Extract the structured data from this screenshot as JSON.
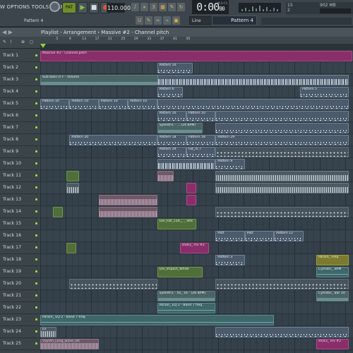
{
  "toolbar": {
    "menu": "W OPTIONS TOOLS HELP",
    "pattern_song_toggle": "PAT",
    "play_icon": "play-icon",
    "stop_icon": "stop-icon",
    "record_icon": "record-icon",
    "tempo": "110.000",
    "time": "0:00",
    "time_small": "00",
    "time_label": "M:S:CS",
    "cpu_value": "15",
    "cpu_value_b": "2",
    "memory": "902 MB",
    "accent_color": "#8dc63f",
    "record_color": "#e0523d"
  },
  "row2": {
    "pattern_label": "Pattern 4",
    "snap": "Line",
    "pattern_select": "Pattern 4"
  },
  "playlist": {
    "nav": "◀ ▶",
    "title": "Playlist - Arrangement › Massive #2 - Channel pitch"
  },
  "ruler": [
    "5",
    "9",
    "13",
    "17",
    "21",
    "25",
    "29",
    "33",
    "37",
    "41",
    "45"
  ],
  "tracks": [
    {
      "name": "Track 1"
    },
    {
      "name": "Track 2"
    },
    {
      "name": "Track 3"
    },
    {
      "name": "Track 4"
    },
    {
      "name": "Track 5"
    },
    {
      "name": "Track 6"
    },
    {
      "name": "Track 7"
    },
    {
      "name": "Track 8"
    },
    {
      "name": "Track 9"
    },
    {
      "name": "Track 10"
    },
    {
      "name": "Track 11"
    },
    {
      "name": "Track 12"
    },
    {
      "name": "Track 13"
    },
    {
      "name": "Track 14"
    },
    {
      "name": "Track 15"
    },
    {
      "name": "Track 16"
    },
    {
      "name": "Track 17"
    },
    {
      "name": "Track 18"
    },
    {
      "name": "Track 19"
    },
    {
      "name": "Track 20"
    },
    {
      "name": "Track 21"
    },
    {
      "name": "Track 22"
    },
    {
      "name": "Track 23"
    },
    {
      "name": "Track 24"
    },
    {
      "name": "Track 25"
    }
  ],
  "clips": [
    {
      "t": 0,
      "b": 1,
      "w": 96,
      "k": "k-pink",
      "label": "Massive #2 - Channel pitch"
    },
    {
      "t": 1,
      "b": 37,
      "w": 11,
      "k": "k-pat",
      "label": "Pattern 10"
    },
    {
      "t": 2,
      "b": 1,
      "w": 37,
      "k": "k-auto",
      "label": "Sub bass in F - Volume"
    },
    {
      "t": 2,
      "b": 37,
      "w": 59,
      "k": "k-dense",
      "label": ""
    },
    {
      "t": 3,
      "b": 37,
      "w": 8,
      "k": "k-pat",
      "label": "Pattern 6"
    },
    {
      "t": 3,
      "b": 81,
      "w": 15,
      "k": "k-pat",
      "label": "Pattern 5"
    },
    {
      "t": 4,
      "b": 1,
      "w": 9,
      "k": "k-pat",
      "label": "Pattern 10"
    },
    {
      "t": 4,
      "b": 10,
      "w": 9,
      "k": "k-pat",
      "label": "Pattern 10"
    },
    {
      "t": 4,
      "b": 19,
      "w": 9,
      "k": "k-pat",
      "label": "Pattern 10"
    },
    {
      "t": 4,
      "b": 28,
      "w": 9,
      "k": "k-pat",
      "label": "Pattern 10"
    },
    {
      "t": 4,
      "b": 37,
      "w": 59,
      "k": "k-pat",
      "label": ""
    },
    {
      "t": 5,
      "b": 37,
      "w": 9,
      "k": "k-pat",
      "label": "Pattern 10"
    },
    {
      "t": 5,
      "b": 46,
      "w": 9,
      "k": "k-pat",
      "label": "Pattern 10"
    },
    {
      "t": 5,
      "b": 55,
      "w": 41,
      "k": "k-pat",
      "label": ""
    },
    {
      "t": 6,
      "b": 37,
      "w": 14,
      "k": "k-auto",
      "label": "Sylenth1 - ... (24 BPM)"
    },
    {
      "t": 6,
      "b": 55,
      "w": 41,
      "k": "k-pat",
      "label": ""
    },
    {
      "t": 7,
      "b": 10,
      "w": 27,
      "k": "k-pat",
      "label": "Pattern 20"
    },
    {
      "t": 7,
      "b": 37,
      "w": 9,
      "k": "k-pat",
      "label": "Pattern 18"
    },
    {
      "t": 7,
      "b": 46,
      "w": 9,
      "k": "k-pat",
      "label": "Pattern 18"
    },
    {
      "t": 7,
      "b": 55,
      "w": 41,
      "k": "k-pat",
      "label": "Pattern 29"
    },
    {
      "t": 8,
      "b": 37,
      "w": 9,
      "k": "k-pat",
      "label": "Pattern 29"
    },
    {
      "t": 8,
      "b": 46,
      "w": 9,
      "k": "k-pat",
      "label": "Fat_m 7"
    },
    {
      "t": 8,
      "b": 55,
      "w": 41,
      "k": "k-dot",
      "label": ""
    },
    {
      "t": 9,
      "b": 37,
      "w": 18,
      "k": "k-dense",
      "label": ""
    },
    {
      "t": 9,
      "b": 55,
      "w": 9,
      "k": "k-pat",
      "label": "Pattern 9"
    },
    {
      "t": 10,
      "b": 9,
      "w": 4,
      "k": "k-green",
      "label": ""
    },
    {
      "t": 10,
      "b": 37,
      "w": 5,
      "k": "k-rose",
      "label": ""
    },
    {
      "t": 10,
      "b": 55,
      "w": 41,
      "k": "k-wave",
      "label": ""
    },
    {
      "t": 11,
      "b": 9,
      "w": 4,
      "k": "k-wave",
      "label": ""
    },
    {
      "t": 11,
      "b": 46,
      "w": 3,
      "k": "k-pink",
      "label": ""
    },
    {
      "t": 11,
      "b": 55,
      "w": 41,
      "k": "k-wave",
      "label": ""
    },
    {
      "t": 12,
      "b": 19,
      "w": 18,
      "k": "k-rose",
      "label": ""
    },
    {
      "t": 12,
      "b": 46,
      "w": 3,
      "k": "k-pink",
      "label": ""
    },
    {
      "t": 13,
      "b": 5,
      "w": 3,
      "k": "k-green",
      "label": ""
    },
    {
      "t": 13,
      "b": 19,
      "w": 18,
      "k": "k-rose",
      "label": ""
    },
    {
      "t": 13,
      "b": 55,
      "w": 41,
      "k": "k-dot",
      "label": ""
    },
    {
      "t": 14,
      "b": 37,
      "w": 12,
      "k": "k-green",
      "label": "Lev_Fall_120__ _ Stik"
    },
    {
      "t": 15,
      "b": 55,
      "w": 9,
      "k": "k-pat",
      "label": "Patt"
    },
    {
      "t": 15,
      "b": 64,
      "w": 9,
      "k": "k-pat",
      "label": "Patt"
    },
    {
      "t": 15,
      "b": 73,
      "w": 9,
      "k": "k-pat",
      "label": "Pattern 12"
    },
    {
      "t": 16,
      "b": 9,
      "w": 3,
      "k": "k-green",
      "label": ""
    },
    {
      "t": 16,
      "b": 44,
      "w": 9,
      "k": "k-pink",
      "label": "shot3_ mv #2"
    },
    {
      "t": 17,
      "b": 55,
      "w": 9,
      "k": "k-pat",
      "label": "Pattern 3"
    },
    {
      "t": 17,
      "b": 86,
      "w": 10,
      "k": "k-yellow",
      "label": "Param_ Freq"
    },
    {
      "t": 18,
      "b": 37,
      "w": 14,
      "k": "k-green",
      "label": "Lev_Impact_White"
    },
    {
      "t": 18,
      "b": 86,
      "w": 10,
      "k": "k-teal",
      "label": "Cymatic_ BPM"
    },
    {
      "t": 19,
      "b": 10,
      "w": 27,
      "k": "k-dot",
      "label": ""
    },
    {
      "t": 19,
      "b": 55,
      "w": 41,
      "k": "k-dot",
      "label": ""
    },
    {
      "t": 20,
      "b": 37,
      "w": 18,
      "k": "k-auto",
      "label": "Sylenth1 - Xx_ 16 - (26 BPM)"
    },
    {
      "t": 20,
      "b": 86,
      "w": 10,
      "k": "k-auto",
      "label": "Cymatic_ Bar 10"
    },
    {
      "t": 21,
      "b": 37,
      "w": 18,
      "k": "k-teal",
      "label": "Param_ EQ 2 - Band 7 freq"
    },
    {
      "t": 22,
      "b": 1,
      "w": 72,
      "k": "k-teal",
      "label": "Param_ EQ 2 - Band 7 freq"
    },
    {
      "t": 23,
      "b": 1,
      "w": 5,
      "k": "k-wave",
      "label": "Ex"
    },
    {
      "t": 23,
      "b": 55,
      "w": 41,
      "k": "k-pat",
      "label": ""
    },
    {
      "t": 24,
      "b": 1,
      "w": 18,
      "k": "k-rose",
      "label": "vSynth_Long_wave_vtc"
    },
    {
      "t": 24,
      "b": 86,
      "w": 10,
      "k": "k-pink",
      "label": "shot3_ mv #2"
    }
  ]
}
